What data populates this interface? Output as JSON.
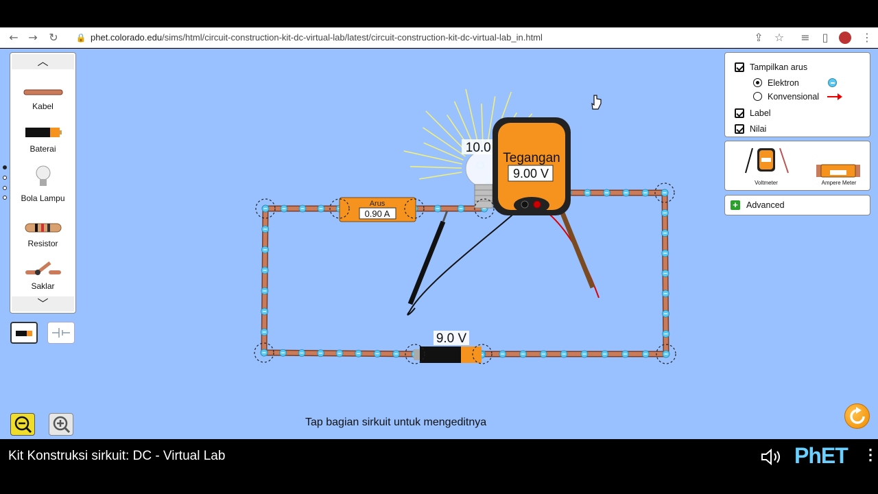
{
  "browser": {
    "url_host": "phet.colorado.edu",
    "url_path": "/sims/html/circuit-construction-kit-dc-virtual-lab/latest/circuit-construction-kit-dc-virtual-lab_in.html"
  },
  "toolbox": {
    "items": [
      {
        "label": "Kabel",
        "icon": "wire-icon"
      },
      {
        "label": "Baterai",
        "icon": "battery-icon"
      },
      {
        "label": "Bola Lampu",
        "icon": "light-bulb-icon"
      },
      {
        "label": "Resistor",
        "icon": "resistor-icon"
      },
      {
        "label": "Saklar",
        "icon": "switch-icon"
      }
    ]
  },
  "settings": {
    "show_current": {
      "label": "Tampilkan arus",
      "checked": true
    },
    "electron": {
      "label": "Elektron",
      "selected": true
    },
    "conventional": {
      "label": "Konvensional",
      "selected": false
    },
    "labels": {
      "label": "Label",
      "checked": true
    },
    "values": {
      "label": "Nilai",
      "checked": true
    }
  },
  "meters": {
    "voltmeter_label": "Voltmeter",
    "ammeter_label": "Ampere Meter"
  },
  "advanced": {
    "label": "Advanced"
  },
  "circuit": {
    "bulb_resistance": "10.0 Ω",
    "ammeter_title": "Arus",
    "ammeter_value": "0.90 A",
    "battery_voltage": "9.0 V",
    "voltmeter_title": "Tegangan",
    "voltmeter_value": "9.00 V"
  },
  "hint": "Tap bagian sirkuit untuk mengeditnya",
  "footer": {
    "title": "Kit Konstruksi sirkuit: DC - Virtual Lab",
    "logo": "PhET"
  },
  "colors": {
    "background": "#99c0ff",
    "wire": "#c97b5a",
    "electron": "#5ac8f0",
    "meter_orange": "#f6931e",
    "accent_green": "#2ca02c"
  }
}
